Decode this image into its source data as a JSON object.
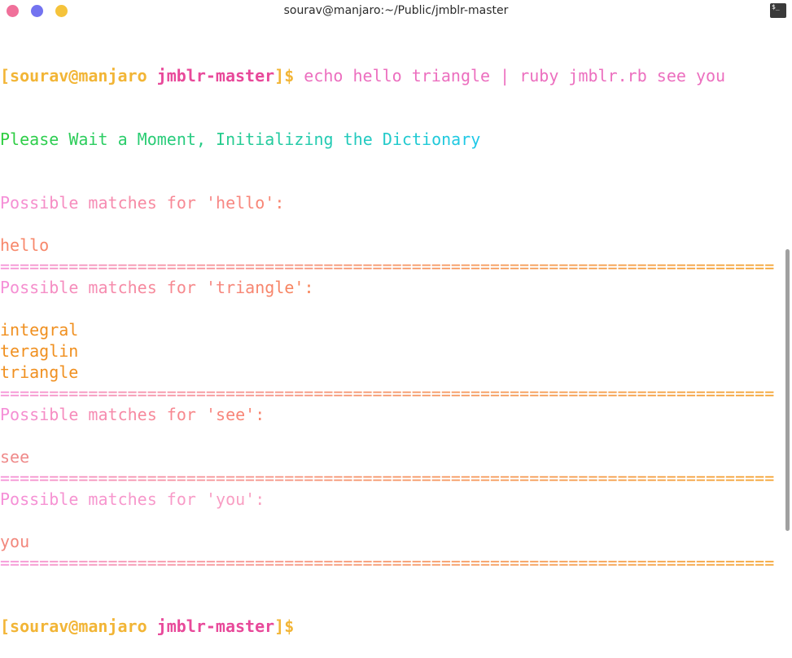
{
  "window": {
    "title": "sourav@manjaro:~/Public/jmblr-master"
  },
  "prompt": {
    "open_bracket": "[",
    "user_host": "sourav@manjaro",
    "space": " ",
    "dir": "jmblr-master",
    "close_dollar": "]$",
    "command": " echo hello triangle | ruby jmblr.rb see you"
  },
  "output": {
    "init": "Please Wait a Moment, Initializing the Dictionary",
    "separator": "===============================================================================",
    "groups": [
      {
        "header": "Possible matches for 'hello':",
        "matches": [
          "hello"
        ]
      },
      {
        "header": "Possible matches for 'triangle':",
        "matches": [
          "integral",
          "teraglin",
          "triangle"
        ]
      },
      {
        "header": "Possible matches for 'see':",
        "matches": [
          "see"
        ]
      },
      {
        "header": "Possible matches for 'you':",
        "matches": [
          "you"
        ]
      }
    ]
  },
  "colors": {
    "init_start": "#2fce41",
    "init_end": "#1fc9e8",
    "header_start": "#f58fd7",
    "header_end": "#f8856e",
    "prompt_yellow": "#f2b536",
    "prompt_pink": "#e8499a"
  }
}
